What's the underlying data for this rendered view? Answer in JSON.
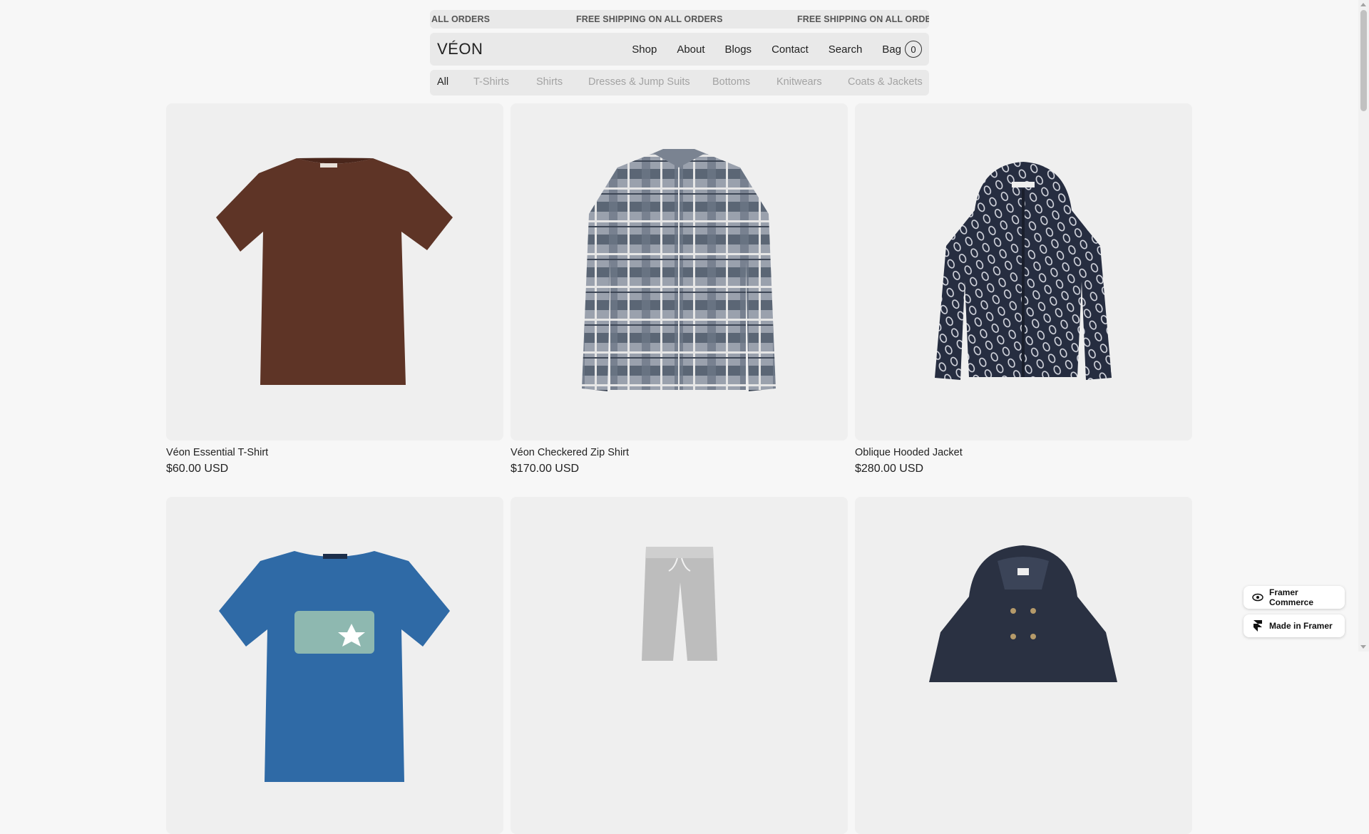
{
  "announcement": {
    "text_partial": "ALL ORDERS",
    "text": "FREE SHIPPING ON ALL ORDERS"
  },
  "header": {
    "logo": "VÉON",
    "nav": [
      "Shop",
      "About",
      "Blogs",
      "Contact",
      "Search"
    ],
    "bag_label": "Bag",
    "bag_count": "0"
  },
  "categories": {
    "items": [
      "All",
      "T-Shirts",
      "Shirts",
      "Dresses & Jump Suits",
      "Bottoms",
      "Knitwears",
      "Coats & Jackets"
    ],
    "active": "All"
  },
  "products": [
    {
      "name": "Véon Essential T-Shirt",
      "price": "$60.00 USD"
    },
    {
      "name": "Véon Checkered Zip Shirt",
      "price": "$170.00 USD"
    },
    {
      "name": "Oblique Hooded Jacket",
      "price": "$280.00 USD"
    },
    {
      "name": "",
      "price": ""
    },
    {
      "name": "",
      "price": ""
    },
    {
      "name": "",
      "price": ""
    }
  ],
  "badges": {
    "commerce": "Framer Commerce",
    "made_in": "Made in Framer"
  },
  "colors": {
    "background": "#f7f7f7",
    "bar": "#e9e9e9",
    "card": "#efefef",
    "inactive_text": "#a3a3a3"
  }
}
